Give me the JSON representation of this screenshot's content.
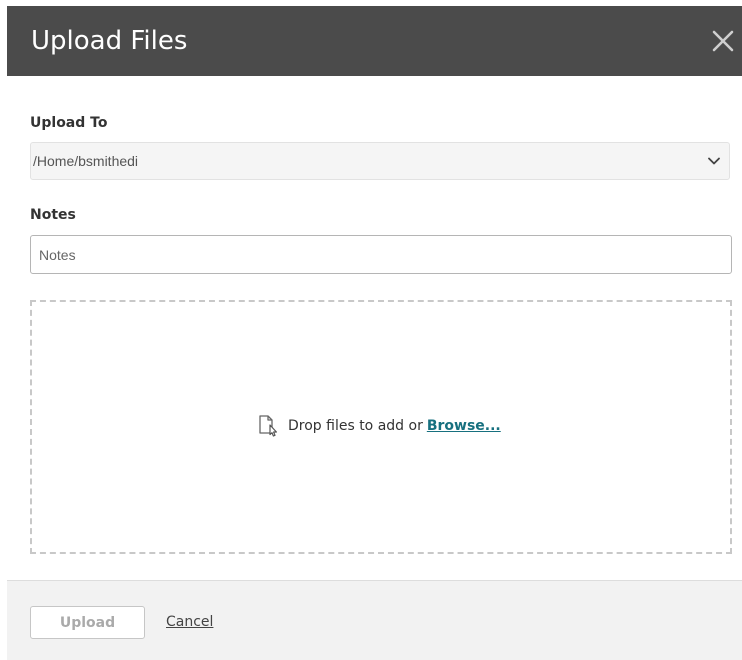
{
  "dialog": {
    "title": "Upload Files",
    "close_icon": "close-icon"
  },
  "upload_to": {
    "label": "Upload To",
    "selected": "/Home/bsmithedi",
    "chevron_icon": "chevron-down-icon"
  },
  "notes": {
    "label": "Notes",
    "placeholder": "Notes",
    "value": ""
  },
  "drop_zone": {
    "icon": "file-upload-icon",
    "text": "Drop files to add or",
    "browse_label": "Browse..."
  },
  "footer": {
    "upload_label": "Upload",
    "cancel_label": "Cancel"
  },
  "colors": {
    "header_bg": "#4b4b4b",
    "link": "#17707f",
    "footer_bg": "#f2f2f2"
  }
}
